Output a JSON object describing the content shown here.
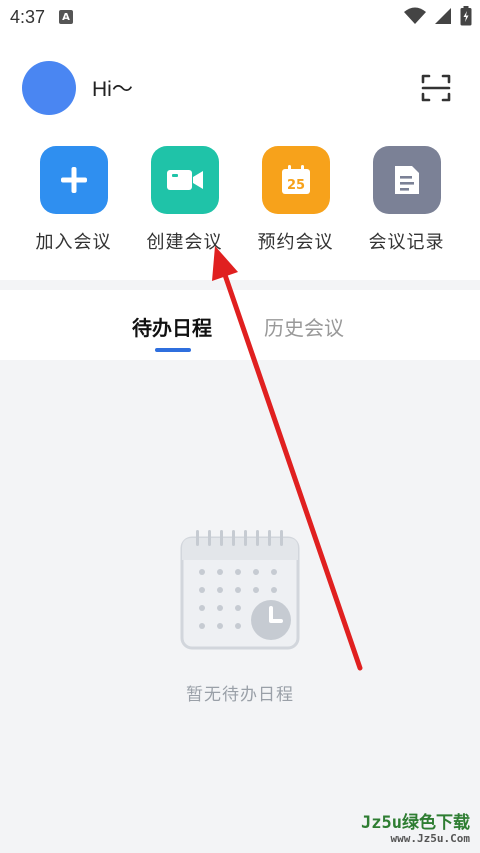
{
  "status_bar": {
    "time": "4:37",
    "notification_letter": "A"
  },
  "header": {
    "greeting": "Hi～"
  },
  "actions": [
    {
      "label": "加入会议",
      "icon": "plus-icon",
      "color": "#2f8ff0"
    },
    {
      "label": "创建会议",
      "icon": "video-camera-icon",
      "color": "#1fc3a8"
    },
    {
      "label": "预约会议",
      "icon": "calendar-icon",
      "color": "#f7a21b",
      "icon_text": "25"
    },
    {
      "label": "会议记录",
      "icon": "document-icon",
      "color": "#7b8196"
    }
  ],
  "tabs": [
    {
      "label": "待办日程",
      "active": true
    },
    {
      "label": "历史会议",
      "active": false
    }
  ],
  "empty_state": {
    "text": "暂无待办日程",
    "icon": "calendar-clock-icon"
  },
  "annotation": {
    "type": "red-arrow",
    "color": "#e02020",
    "points_to": "创建会议"
  },
  "watermark": {
    "line1": "Jz5u绿色下载",
    "line2": "www.Jz5u.Com"
  },
  "colors": {
    "accent": "#2f6fde",
    "background_gray": "#f3f4f6"
  }
}
